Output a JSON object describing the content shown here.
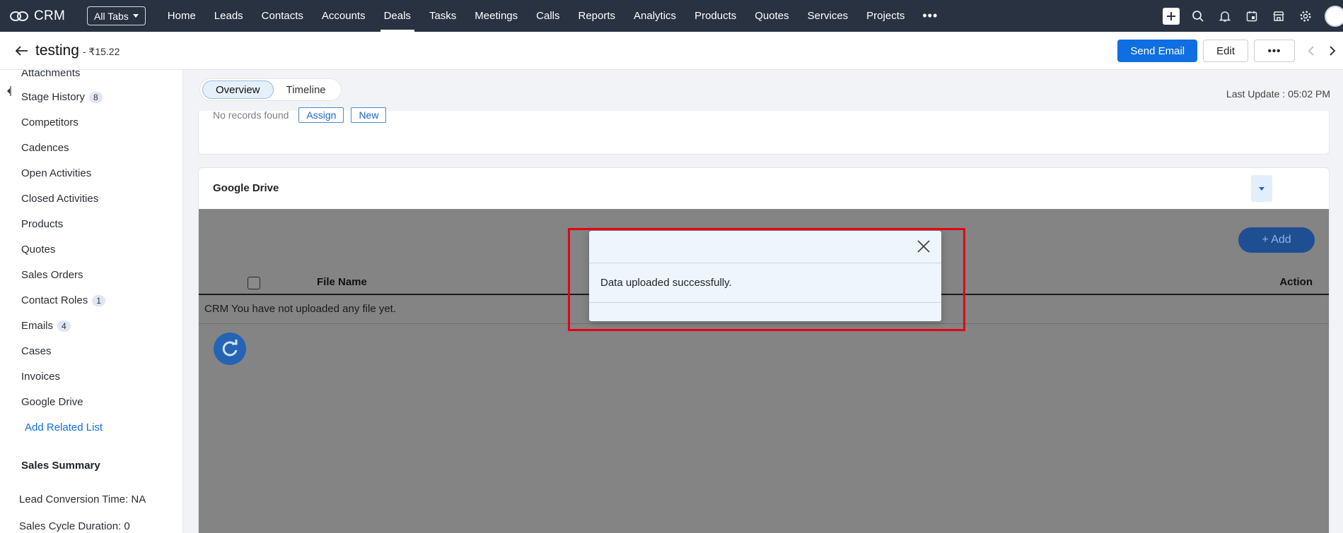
{
  "topnav": {
    "brand": "CRM",
    "all_tabs": "All Tabs",
    "links": [
      "Home",
      "Leads",
      "Contacts",
      "Accounts",
      "Deals",
      "Tasks",
      "Meetings",
      "Calls",
      "Reports",
      "Analytics",
      "Products",
      "Quotes",
      "Services",
      "Projects"
    ],
    "active": "Deals",
    "more": "•••",
    "icons": [
      "plus-icon",
      "search-icon",
      "bell-icon",
      "calendar-icon",
      "marketplace-icon",
      "gear-icon",
      "avatar"
    ]
  },
  "record": {
    "title": "testing",
    "amount": "- ₹15.22",
    "send_email": "Send Email",
    "edit": "Edit",
    "more": "•••"
  },
  "sidebar": {
    "items": [
      {
        "label": "Attachments",
        "badge": ""
      },
      {
        "label": "Stage History",
        "badge": "8"
      },
      {
        "label": "Competitors",
        "badge": ""
      },
      {
        "label": "Cadences",
        "badge": ""
      },
      {
        "label": "Open Activities",
        "badge": ""
      },
      {
        "label": "Closed Activities",
        "badge": ""
      },
      {
        "label": "Products",
        "badge": ""
      },
      {
        "label": "Quotes",
        "badge": ""
      },
      {
        "label": "Sales Orders",
        "badge": ""
      },
      {
        "label": "Contact Roles",
        "badge": "1"
      },
      {
        "label": "Emails",
        "badge": "4"
      },
      {
        "label": "Cases",
        "badge": ""
      },
      {
        "label": "Invoices",
        "badge": ""
      },
      {
        "label": "Google Drive",
        "badge": ""
      }
    ],
    "add_related": "Add Related List",
    "summary_heading": "Sales Summary",
    "summary": [
      "Lead Conversion Time: NA",
      "Sales Cycle Duration: 0"
    ]
  },
  "main": {
    "tabs": [
      "Overview",
      "Timeline"
    ],
    "active_tab": "Overview",
    "last_update": "Last Update : 05:02 PM",
    "no_records": "No records found",
    "assign": "Assign",
    "new": "New",
    "google_drive": {
      "title": "Google Drive",
      "add": "+ Add",
      "col_file": "File Name",
      "col_action": "Action",
      "empty": "CRM You have not uploaded any file yet."
    }
  },
  "modal": {
    "message": "Data uploaded successfully."
  },
  "colors": {
    "nav_bg": "#283241",
    "primary": "#0f6fe0",
    "overlay": "#848484",
    "highlight": "#e60012"
  }
}
